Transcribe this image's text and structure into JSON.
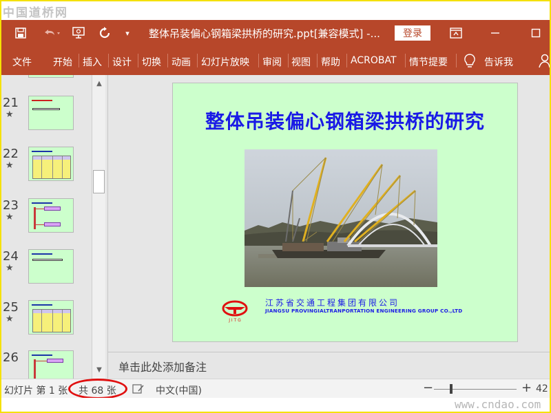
{
  "watermark": {
    "top": "中国道桥网",
    "bottom": "www.cndao.com"
  },
  "titlebar": {
    "doc_title": "整体吊装偏心钢箱梁拱桥的研究.ppt[兼容模式]  -...",
    "login_label": "登录",
    "icons": [
      "save-icon",
      "undo-icon",
      "present-from-start-icon",
      "redo-icon",
      "customize-qat-icon",
      "ribbon-display-options-icon",
      "minimize-icon",
      "maximize-icon"
    ]
  },
  "ribbon": {
    "tabs": [
      "文件",
      "开始",
      "插入",
      "设计",
      "切换",
      "动画",
      "幻灯片放映",
      "审阅",
      "视图",
      "帮助",
      "ACROBAT",
      "情节提要"
    ],
    "tell_me": "告诉我"
  },
  "thumbnails": [
    {
      "num": "21"
    },
    {
      "num": "22"
    },
    {
      "num": "23"
    },
    {
      "num": "24"
    },
    {
      "num": "25"
    },
    {
      "num": "26"
    }
  ],
  "slide": {
    "title": "整体吊装偏心钢箱梁拱桥的研究",
    "logo_text": "J I T G",
    "company_cn": "江苏省交通工程集团有限公司",
    "company_en": "JIANGSU PROVINGIALTRANPORTATION ENGINEERING GROUP CO.,LTD",
    "bg_color": "#ccffcc",
    "title_color": "#1a1ae6"
  },
  "notes": {
    "placeholder": "单击此处添加备注"
  },
  "statusbar": {
    "slide_info": "幻灯片 第 1 张",
    "total": "共 68 张",
    "language": "中文(中国)",
    "zoom": "42"
  },
  "colors": {
    "accent": "#b7472a",
    "highlight_oval": "#e01010"
  }
}
